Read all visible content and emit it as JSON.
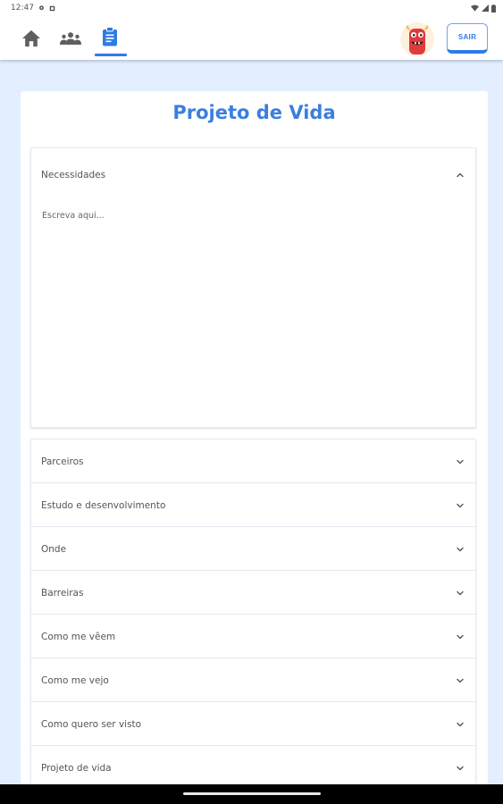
{
  "status_bar": {
    "time": "12:47"
  },
  "app_bar": {
    "nav": [
      {
        "name": "home",
        "icon": "home-icon"
      },
      {
        "name": "group",
        "icon": "group-icon"
      },
      {
        "name": "clipboard",
        "icon": "clipboard-icon",
        "active": true
      }
    ],
    "avatar_icon": "monster-avatar-icon",
    "logout_label": "SAIR",
    "accent_color": "#2f7be5"
  },
  "page": {
    "title": "Projeto de Vida"
  },
  "expanded_section": {
    "title": "Necessidades",
    "placeholder": "Escreva aqui...",
    "value": ""
  },
  "sections": [
    {
      "title": "Parceiros"
    },
    {
      "title": "Estudo e desenvolvimento"
    },
    {
      "title": "Onde"
    },
    {
      "title": "Barreiras"
    },
    {
      "title": "Como me vêem"
    },
    {
      "title": "Como me vejo"
    },
    {
      "title": "Como quero ser visto"
    },
    {
      "title": "Projeto de vida"
    }
  ]
}
